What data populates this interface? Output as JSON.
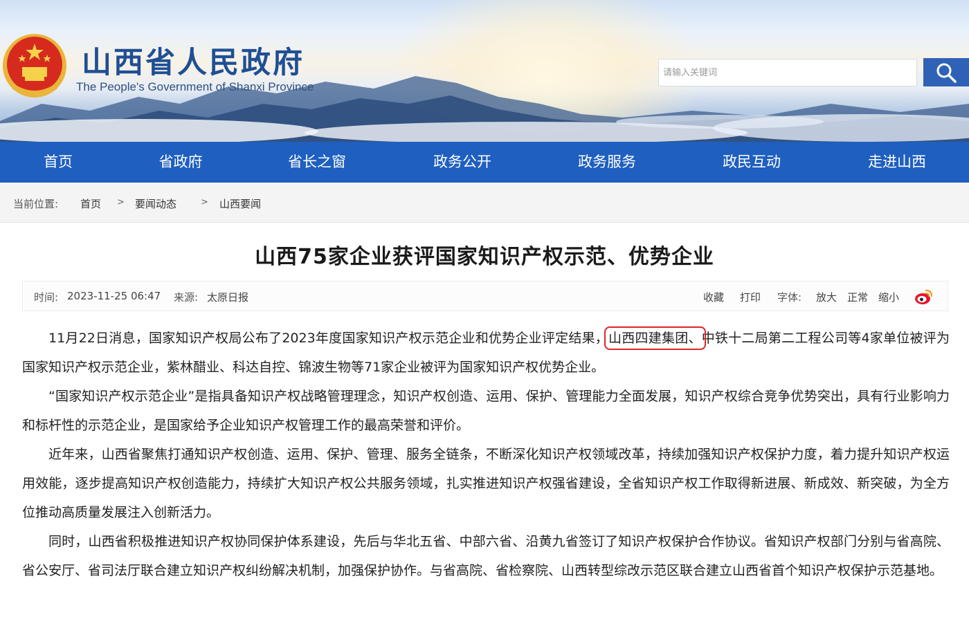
{
  "header": {
    "title": "山西省人民政府",
    "subtitle": "The People's Government of Shanxi Province",
    "search_placeholder": "请输入关键词"
  },
  "nav": {
    "items": [
      "首页",
      "省政府",
      "省长之窗",
      "政务公开",
      "政务服务",
      "政民互动",
      "走进山西"
    ]
  },
  "breadcrumb": {
    "label": "当前位置:",
    "items": [
      "首页",
      "要闻动态",
      "山西要闻"
    ],
    "separator": ">"
  },
  "article": {
    "title": "山西75家企业获评国家知识产权示范、优势企业",
    "meta": {
      "time_label": "时间:",
      "time_value": "2023-11-25 06:47",
      "source_label": "来源:",
      "source_value": "太原日报",
      "favorite": "收藏",
      "print": "打印",
      "font_label": "字体:",
      "font_larger": "放大",
      "font_normal": "正常",
      "font_smaller": "缩小"
    },
    "p1_before": "11月22日消息，国家知识产权局公布了2023年度国家知识产权示范企业和优势企业评定结果，",
    "p1_highlight": "山西四建集团、",
    "p1_after": "中铁十二局第二工程公司等4家单位被评为国家知识产权示范企业，紫林醋业、科达自控、锦波生物等71家企业被评为国家知识产权优势企业。",
    "p2": "“国家知识产权示范企业”是指具备知识产权战略管理理念，知识产权创造、运用、保护、管理能力全面发展，知识产权综合竞争优势突出，具有行业影响力和标杆性的示范企业，是国家给予企业知识产权管理工作的最高荣誉和评价。",
    "p3": "近年来，山西省聚焦打通知识产权创造、运用、保护、管理、服务全链条，不断深化知识产权领域改革，持续加强知识产权保护力度，着力提升知识产权运用效能，逐步提高知识产权创造能力，持续扩大知识产权公共服务领域，扎实推进知识产权强省建设，全省知识产权工作取得新进展、新成效、新突破，为全方位推动高质量发展注入创新活力。",
    "p4": "同时，山西省积极推进知识产权协同保护体系建设，先后与华北五省、中部六省、沿黄九省签订了知识产权保护合作协议。省知识产权部门分别与省高院、省公安厅、省司法厅联合建立知识产权纠纷解决机制，加强保护协作。与省高院、省检察院、山西转型综改示范区联合建立山西省首个知识产权保护示范基地。"
  },
  "colors": {
    "nav_bg": "#1f5fbf",
    "title_blue": "#1f4f95",
    "search_button": "#2f62b7",
    "highlight_box": "#e02525"
  },
  "icons": {
    "emblem": "national-emblem-icon",
    "search": "search-icon",
    "share": "weibo-icon"
  }
}
